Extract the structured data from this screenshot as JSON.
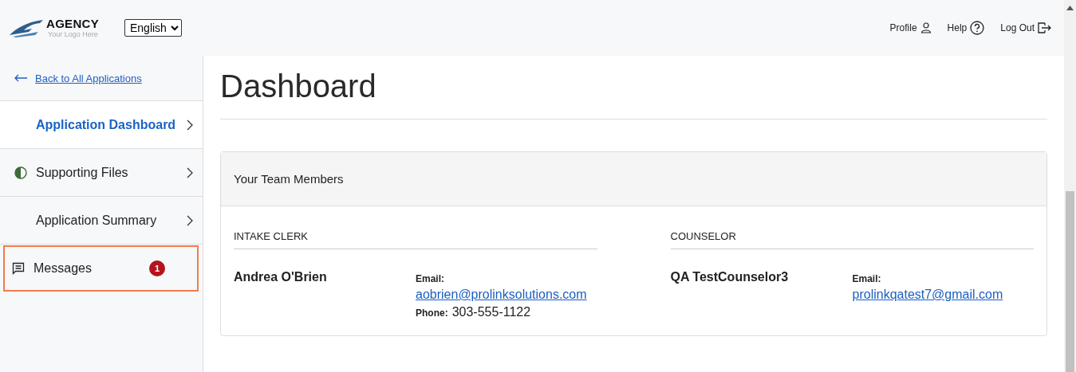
{
  "header": {
    "logo": {
      "name": "AGENCY",
      "tagline": "Your Logo Here"
    },
    "language": "English",
    "links": [
      {
        "label": "Profile",
        "kind": "profile"
      },
      {
        "label": "Help",
        "kind": "help"
      },
      {
        "label": "Log Out",
        "kind": "logout"
      }
    ]
  },
  "sidebar": {
    "back_link": "Back to All Applications",
    "items": [
      {
        "label": "Application Dashboard",
        "kind": "page",
        "selected": true,
        "focused": false
      },
      {
        "label": "Supporting Files",
        "kind": "status",
        "selected": false,
        "focused": false
      },
      {
        "label": "Application Summary",
        "kind": "page",
        "selected": false,
        "focused": false
      },
      {
        "label": "Messages",
        "kind": "messages",
        "selected": false,
        "focused": true,
        "badge": "1"
      }
    ]
  },
  "main": {
    "title": "Dashboard",
    "card": {
      "title": "Your Team Members",
      "members": [
        {
          "role": "INTAKE CLERK",
          "name": "Andrea O'Brien",
          "email_label": "Email:",
          "email": "aobrien@prolinksolutions.com",
          "phone_label": "Phone:",
          "phone": "303-555-1122"
        },
        {
          "role": "COUNSELOR",
          "name": "QA TestCounselor3",
          "email_label": "Email:",
          "email": "prolinkqatest7@gmail.com"
        }
      ]
    }
  }
}
